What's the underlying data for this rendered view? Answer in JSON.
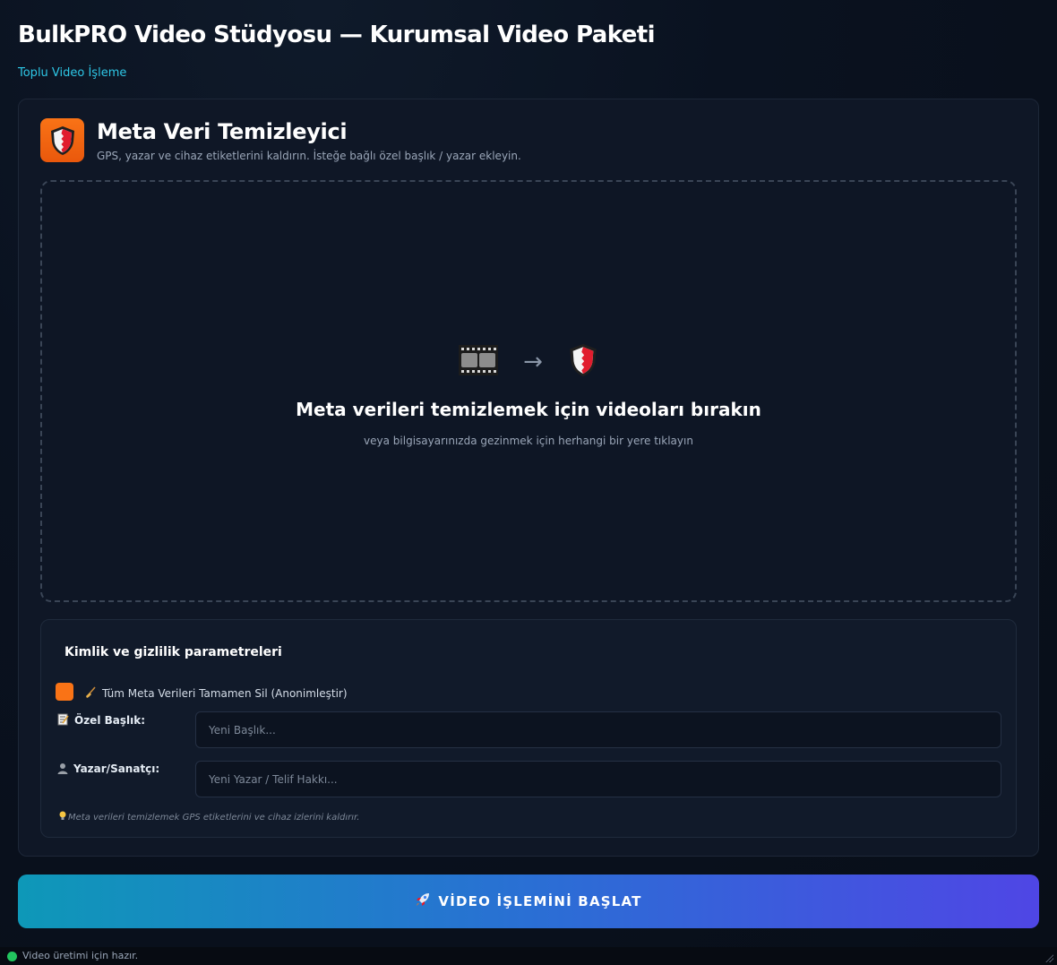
{
  "app": {
    "title": "BulkPRO Video Stüdyosu — Kurumsal Video Paketi",
    "subnav": "Toplu Video İşleme"
  },
  "tool": {
    "icon": "shield-icon",
    "title": "Meta Veri Temizleyici",
    "description": "GPS, yazar ve cihaz etiketlerini kaldırın. İsteğe bağlı özel başlık / yazar ekleyin."
  },
  "dropzone": {
    "source_icon": "film-strip-icon",
    "arrow": "→",
    "target_icon": "shield-icon",
    "title": "Meta verileri temizlemek için videoları bırakın",
    "subtitle": "veya bilgisayarınızda gezinmek için herhangi bir yere tıklayın"
  },
  "params": {
    "title": "Kimlik ve gizlilik parametreleri",
    "strip_all": {
      "checked": true,
      "icon": "broom-icon",
      "label": "Tüm Meta Verileri Tamamen Sil (Anonimleştir)"
    },
    "title_field": {
      "icon": "memo-icon",
      "label": "Özel Başlık:",
      "value": "",
      "placeholder": "Yeni Başlık..."
    },
    "author_field": {
      "icon": "person-silhouette-icon",
      "label": "Yazar/Sanatçı:",
      "value": "",
      "placeholder": "Yeni Yazar / Telif Hakkı..."
    },
    "hint": {
      "icon": "lightbulb-icon",
      "text": "Meta verileri temizlemek GPS etiketlerini ve cihaz izlerini kaldırır."
    }
  },
  "action": {
    "icon": "rocket-icon",
    "label": "VİDEO İŞLEMİNİ BAŞLAT"
  },
  "status": {
    "color": "#22c55e",
    "text": "Video üretimi için hazır."
  }
}
